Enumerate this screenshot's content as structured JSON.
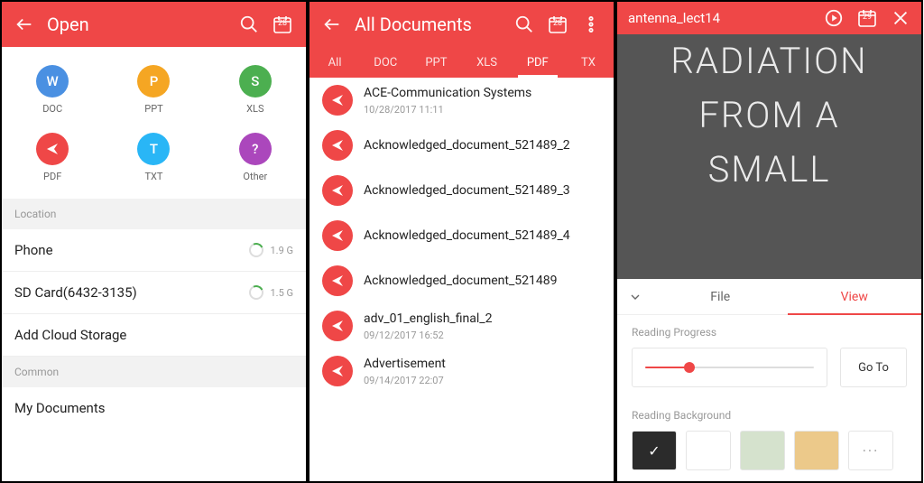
{
  "panel1": {
    "title": "Open",
    "calendar_badge": "28",
    "types": [
      {
        "label": "DOC",
        "glyph": "W",
        "cls": "c-doc"
      },
      {
        "label": "PPT",
        "glyph": "P",
        "cls": "c-ppt"
      },
      {
        "label": "XLS",
        "glyph": "S",
        "cls": "c-xls"
      },
      {
        "label": "PDF",
        "glyph": "",
        "cls": "c-pdf"
      },
      {
        "label": "TXT",
        "glyph": "T",
        "cls": "c-txt"
      },
      {
        "label": "Other",
        "glyph": "?",
        "cls": "c-oth"
      }
    ],
    "section_location": "Location",
    "loc_phone": "Phone",
    "loc_phone_size": "1.9 G",
    "loc_sd": "SD Card(6432-3135)",
    "loc_sd_size": "1.5 G",
    "add_cloud": "Add Cloud Storage",
    "section_common": "Common",
    "my_docs": "My Documents"
  },
  "panel2": {
    "title": "All Documents",
    "calendar_badge": "28",
    "tabs": [
      "All",
      "DOC",
      "PPT",
      "XLS",
      "PDF",
      "TX"
    ],
    "active_tab": 4,
    "docs": [
      {
        "name": "ACE-Communication Systems",
        "meta": "10/28/2017   11:11"
      },
      {
        "name": "Acknowledged_document_521489_2",
        "meta": ""
      },
      {
        "name": "Acknowledged_document_521489_3",
        "meta": ""
      },
      {
        "name": "Acknowledged_document_521489_4",
        "meta": ""
      },
      {
        "name": "Acknowledged_document_521489",
        "meta": ""
      },
      {
        "name": "adv_01_english_final_2",
        "meta": "09/12/2017   16:52"
      },
      {
        "name": "Advertisement",
        "meta": "09/14/2017   22:07"
      }
    ]
  },
  "panel3": {
    "title": "antenna_lect14",
    "calendar_badge": "29",
    "body_lines": [
      "RADIATION",
      "FROM A",
      "SMALL"
    ],
    "tab_file": "File",
    "tab_view": "View",
    "reading_progress": "Reading Progress",
    "goto": "Go To",
    "reading_bg": "Reading Background",
    "swatches": [
      {
        "name": "dark",
        "bg": "#2b2b2b",
        "check": true
      },
      {
        "name": "white",
        "bg": "#ffffff"
      },
      {
        "name": "sage",
        "bg": "#d5e2cd"
      },
      {
        "name": "tan",
        "bg": "#ecc98a"
      },
      {
        "name": "more",
        "bg": "#ffffff"
      }
    ]
  }
}
